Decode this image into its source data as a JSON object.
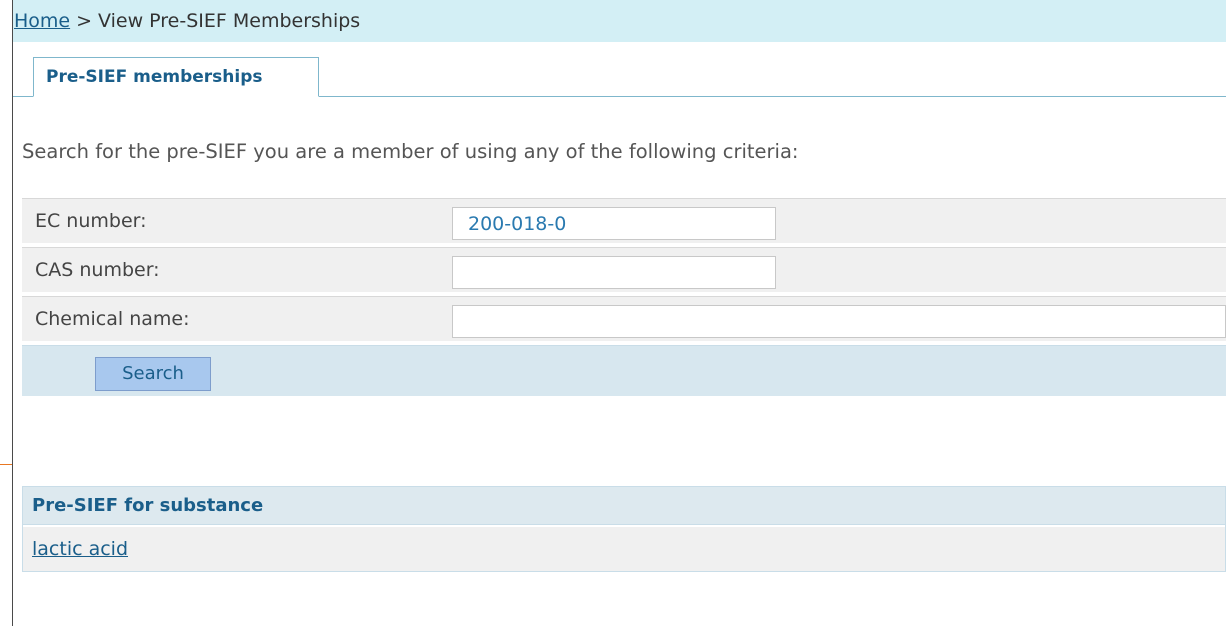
{
  "breadcrumb": {
    "home": "Home",
    "separator": ">",
    "current": "View Pre-SIEF Memberships"
  },
  "tabs": [
    {
      "label": "Pre-SIEF memberships",
      "active": true
    }
  ],
  "intro_text": "Search for the pre-SIEF you are a member of using any of the following criteria:",
  "search_form": {
    "ec_label": "EC number:",
    "ec_value": "200-018-0",
    "cas_label": "CAS number:",
    "cas_value": "",
    "chemical_label": "Chemical name:",
    "chemical_value": "",
    "search_button": "Search"
  },
  "results": {
    "header": "Pre-SIEF for substance",
    "rows": [
      {
        "substance": "lactic acid"
      }
    ]
  },
  "colors": {
    "breadcrumb_bg": "#d3eff5",
    "link": "#1a5e8a",
    "button_bg": "#a8c8ee",
    "accent_orange": "#e87722"
  }
}
